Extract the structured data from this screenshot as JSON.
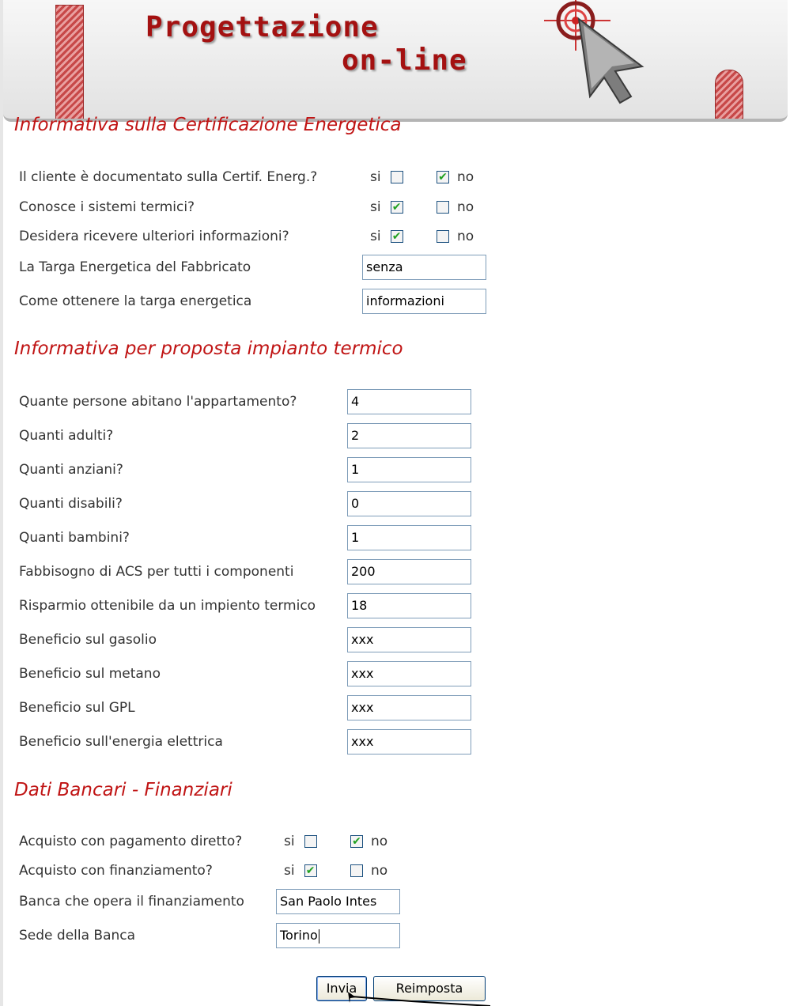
{
  "header": {
    "title_line1": "Progettazione",
    "title_line2": "on-line"
  },
  "certificazione": {
    "title": "Informativa sulla Certificazione Energetica",
    "questions": [
      {
        "label": "Il cliente è documentato sulla Certif. Energ.?",
        "si_label": "si",
        "no_label": "no",
        "si_checked": false,
        "no_checked": true
      },
      {
        "label": "Conosce i sistemi termici?",
        "si_label": "si",
        "no_label": "no",
        "si_checked": true,
        "no_checked": false
      },
      {
        "label": "Desidera ricevere ulteriori informazioni?",
        "si_label": "si",
        "no_label": "no",
        "si_checked": true,
        "no_checked": false
      }
    ],
    "fields": [
      {
        "label": "La Targa Energetica del Fabbricato",
        "value": "senza"
      },
      {
        "label": "Come ottenere la targa energetica",
        "value": "informazioni"
      }
    ]
  },
  "impianto": {
    "title": "Informativa per proposta impianto termico",
    "fields": [
      {
        "label": "Quante persone abitano l'appartamento?",
        "value": "4"
      },
      {
        "label": "Quanti adulti?",
        "value": "2"
      },
      {
        "label": "Quanti anziani?",
        "value": "1"
      },
      {
        "label": "Quanti disabili?",
        "value": "0"
      },
      {
        "label": "Quanti bambini?",
        "value": "1"
      },
      {
        "label": "Fabbisogno di ACS per tutti i componenti",
        "value": "200"
      },
      {
        "label": "Risparmio ottenibile da un impiento termico",
        "value": "18"
      },
      {
        "label": "Beneficio sul gasolio",
        "value": "xxx"
      },
      {
        "label": "Beneficio sul metano",
        "value": "xxx"
      },
      {
        "label": "Beneficio sul GPL",
        "value": "xxx"
      },
      {
        "label": "Beneficio sull'energia elettrica",
        "value": "xxx"
      }
    ]
  },
  "bancari": {
    "title": "Dati Bancari - Finanziari",
    "questions": [
      {
        "label": "Acquisto con pagamento diretto?",
        "si_label": "si",
        "no_label": "no",
        "si_checked": false,
        "no_checked": true
      },
      {
        "label": "Acquisto con finanziamento?",
        "si_label": "si",
        "no_label": "no",
        "si_checked": true,
        "no_checked": false
      }
    ],
    "fields": [
      {
        "label": "Banca che opera il finanziamento",
        "value": "San Paolo Intes"
      },
      {
        "label": "Sede della Banca",
        "value": "Torino"
      }
    ]
  },
  "buttons": {
    "submit_label": "Invia",
    "reset_label": "Reimposta"
  },
  "icons": {
    "header_cursor": "crosshair-cursor-icon",
    "mouse_pointer": "mouse-pointer-icon",
    "checkmark": "✔"
  },
  "colors": {
    "accent_red": "#c01414",
    "title_red": "#a41111",
    "check_green": "#21a121",
    "field_border": "#7f9db9"
  }
}
